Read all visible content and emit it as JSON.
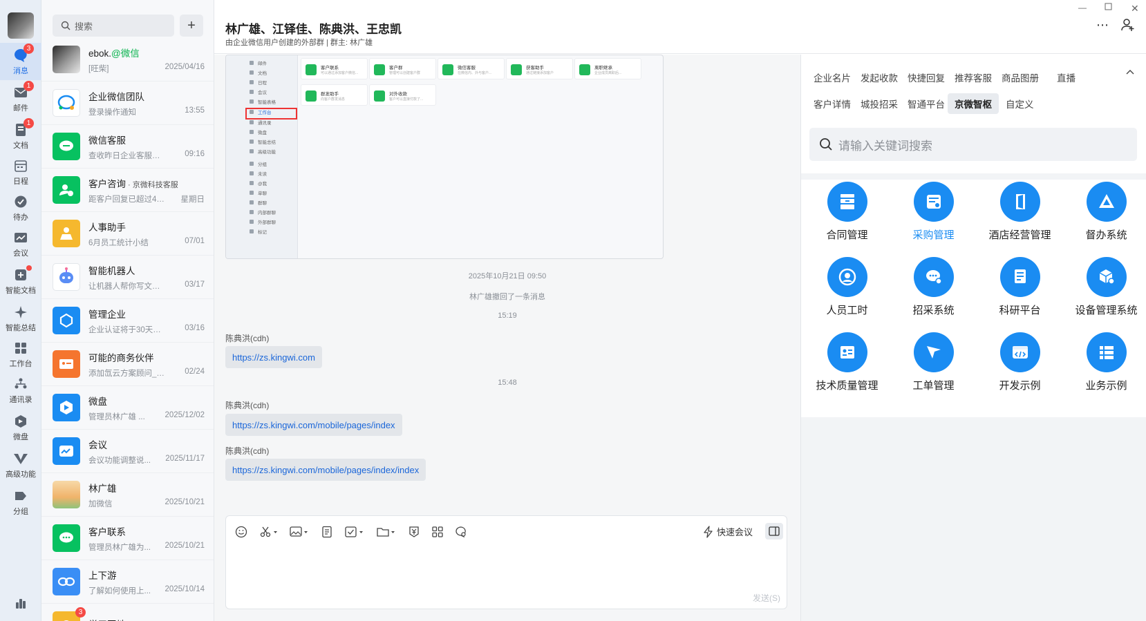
{
  "rail": {
    "items": [
      {
        "label": "消息",
        "icon": "chat-bubble-icon",
        "badge": "3",
        "active": true
      },
      {
        "label": "邮件",
        "icon": "mail-icon",
        "badge": "1"
      },
      {
        "label": "文档",
        "icon": "document-icon",
        "badge": "1"
      },
      {
        "label": "日程",
        "icon": "calendar-icon"
      },
      {
        "label": "待办",
        "icon": "check-circle-icon"
      },
      {
        "label": "会议",
        "icon": "meeting-icon"
      },
      {
        "label": "智能文档",
        "icon": "smart-doc-icon",
        "dot": true
      },
      {
        "label": "智能总结",
        "icon": "sparkle-icon"
      },
      {
        "label": "工作台",
        "icon": "grid-icon"
      },
      {
        "label": "通讯录",
        "icon": "contacts-icon"
      },
      {
        "label": "微盘",
        "icon": "drive-icon"
      },
      {
        "label": "高级功能",
        "icon": "vip-icon"
      },
      {
        "label": "分组",
        "icon": "tag-icon"
      }
    ]
  },
  "convlist": {
    "search_placeholder": "搜索",
    "items": [
      {
        "name": "ebok.",
        "tag": "@微信",
        "preview": "[旺柴]",
        "time": "2025/04/16",
        "avatar": "photo-avatar"
      },
      {
        "name": "企业微信团队",
        "preview": "登录操作通知",
        "time": "13:55",
        "avatar": "wecom-team-icon"
      },
      {
        "name": "微信客服",
        "preview": "查收昨日企业客服数...",
        "time": "09:16",
        "avatar": "wechat-service-icon"
      },
      {
        "name": "客户咨询",
        "sub": " · 京微科技客服",
        "preview": "距客户回复已超过48...",
        "time": "星期日",
        "avatar": "customer-consult-icon"
      },
      {
        "name": "人事助手",
        "preview": "6月员工统计小结",
        "time": "07/01",
        "avatar": "hr-assistant-icon"
      },
      {
        "name": "智能机器人",
        "preview": "让机器人帮你写文档...",
        "time": "03/17",
        "avatar": "robot-icon"
      },
      {
        "name": "管理企业",
        "preview": "企业认证将于30天后...",
        "time": "03/16",
        "avatar": "manage-enterprise-icon"
      },
      {
        "name": "可能的商务伙伴",
        "preview": "添加氙云方案顾问_智...",
        "time": "02/24",
        "avatar": "business-partner-icon"
      },
      {
        "name": "微盘",
        "preview": "管理员林广雄 ...",
        "time": "2025/12/02",
        "avatar": "drive-icon"
      },
      {
        "name": "会议",
        "preview": "会议功能调整说...",
        "time": "2025/11/17",
        "avatar": "meeting-icon"
      },
      {
        "name": "林广雄",
        "preview": "加微信",
        "time": "2025/10/21",
        "avatar": "cartoon-avatar"
      },
      {
        "name": "客户联系",
        "preview": "管理员林广雄为...",
        "time": "2025/10/21",
        "avatar": "customer-contact-icon"
      },
      {
        "name": "上下游",
        "preview": "了解如何使用上...",
        "time": "2025/10/14",
        "avatar": "upstream-downstream-icon"
      },
      {
        "name": "学习园地",
        "preview": "",
        "time": "",
        "avatar": "study-icon",
        "badge": "3"
      }
    ]
  },
  "chat": {
    "title": "林广雄、江铎佳、陈典洪、王忠凯",
    "subtitle": "由企业微信用户创建的外部群 | 群主: 林广雄",
    "preview": {
      "sidebar": [
        "邮件",
        "文档",
        "日程",
        "会议",
        "智能表格",
        "工作台",
        "通讯录",
        "微盘",
        "智能总结",
        "高级功能",
        "分组",
        "未读",
        "@我",
        "单聊",
        "群聊",
        "内部群聊",
        "外部群聊",
        "标记"
      ],
      "cards": [
        {
          "title": "客户联系",
          "desc": "可以通过添加客户微信..."
        },
        {
          "title": "客户群",
          "desc": "管理可以创建客户群"
        },
        {
          "title": "微信客服",
          "desc": "在微信内、外与客户..."
        },
        {
          "title": "获客助手",
          "desc": "通过链接添加客户"
        },
        {
          "title": "离职继承",
          "desc": "企业成员离职后..."
        },
        {
          "title": "群发助手",
          "desc": "向客户群发消息"
        },
        {
          "title": "对外收款",
          "desc": "客户可以直接付款了..."
        }
      ]
    },
    "messages": {
      "ts1": "2025年10月21日 09:50",
      "recall": "林广雄撤回了一条消息",
      "ts2": "15:19",
      "sender1": "陈典洪(cdh)",
      "link1": "https://zs.kingwi.com",
      "ts3": "15:48",
      "sender2": "陈典洪(cdh)",
      "link2": "https://zs.kingwi.com/mobile/pages/index",
      "sender3": "陈典洪(cdh)",
      "link3": "https://zs.kingwi.com/mobile/pages/index/index"
    },
    "composer": {
      "quick_meeting": "快速会议",
      "send": "发送(S)"
    }
  },
  "rpanel": {
    "tabs": [
      "企业名片",
      "发起收款",
      "快捷回复",
      "推荐客服",
      "商品图册",
      "直播",
      "客户详情",
      "城投招采",
      "智通平台",
      "京微智枢",
      "自定义"
    ],
    "active_tab": "京微智枢",
    "search_placeholder": "请输入关键词搜索",
    "apps": [
      {
        "name": "合同管理",
        "icon": "archive-icon"
      },
      {
        "name": "采购管理",
        "icon": "procurement-icon",
        "highlight": true
      },
      {
        "name": "酒店经营管理",
        "icon": "hotel-door-icon"
      },
      {
        "name": "督办系统",
        "icon": "drive-triangle-icon"
      },
      {
        "name": "人员工时",
        "icon": "clock-person-icon"
      },
      {
        "name": "招采系统",
        "icon": "chat-settings-icon"
      },
      {
        "name": "科研平台",
        "icon": "research-doc-icon"
      },
      {
        "name": "设备管理系统",
        "icon": "device-box-icon"
      },
      {
        "name": "技术质量管理",
        "icon": "id-card-icon"
      },
      {
        "name": "工单管理",
        "icon": "paper-plane-icon"
      },
      {
        "name": "开发示例",
        "icon": "code-icon"
      },
      {
        "name": "业务示例",
        "icon": "list-icon"
      }
    ]
  },
  "colors": {
    "accent": "#1a8cf2",
    "badge": "#f54a45",
    "link": "#1a66d9",
    "green": "#07c160"
  }
}
